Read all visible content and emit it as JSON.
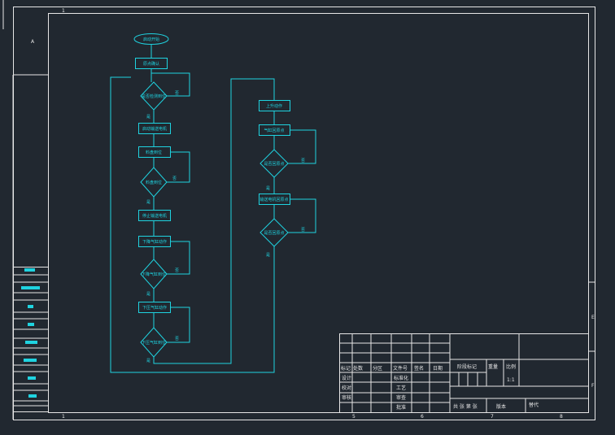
{
  "frame": {
    "zone_top_left": "1",
    "zone_bottom_left": "1",
    "zone_left": "A",
    "zone_right_e": "E",
    "zone_right_f": "F",
    "zone_bottom_nums": [
      "5",
      "6",
      "7",
      "8"
    ]
  },
  "flow": {
    "start": "启动开始",
    "n1": "原点确认",
    "d1": "是否检测到位",
    "n2": "启动输送电机",
    "n3": "料盘到位",
    "d2": "料盘到位",
    "n4": "停止输送电机",
    "n5": "下降气缸动作",
    "d3": "下降气缸到位",
    "n6": "下压气缸动作",
    "d4": "下压气缸到位",
    "r1": "上升动作",
    "r2": "气缸回原点",
    "rd1": "是否回原点",
    "r3": "输送电机回原点",
    "rd2": "是否回原点",
    "yes": "是",
    "no": "否"
  },
  "title_block": {
    "rev_headers": [
      "标记",
      "处数",
      "分区",
      "文件号",
      "签名",
      "日期"
    ],
    "roles": [
      "设计",
      "校对",
      "审核"
    ],
    "std": "标准化",
    "craft": "工艺",
    "review": "审查",
    "approve": "批准",
    "stage": "阶段标记",
    "weight": "重量",
    "scale": "比例",
    "scale_value": "1:1",
    "sheets": "共 张  第 张",
    "version": "版本",
    "replace": "替代"
  }
}
